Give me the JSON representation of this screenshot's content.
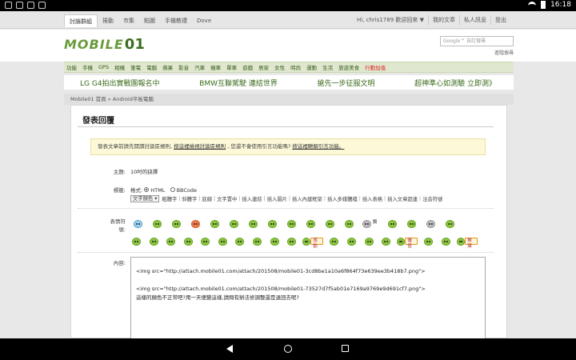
{
  "status_bar": {
    "time": "16:18"
  },
  "top_nav": {
    "tabs": [
      "討論群組",
      "捲動",
      "市集",
      "點圖",
      "手機教禮",
      "Dove"
    ],
    "user_links": [
      "Hi, chris1789 歡迎回來 ▼",
      "我的文章",
      "私人訊息",
      "登出"
    ]
  },
  "header": {
    "logo_text": "MOBILE",
    "logo_num": "01",
    "search_placeholder": "Google™ 自訂搜尋",
    "advanced_search": "進階搜尋"
  },
  "categories": [
    "功能",
    "手機",
    "GPS",
    "相機",
    "筆電",
    "電腦",
    "蘋果",
    "影音",
    "汽車",
    "機車",
    "單車",
    "遊戲",
    "居家",
    "女性",
    "時尚",
    "運動",
    "生活",
    "旅遊美食",
    "行動加值"
  ],
  "promos": [
    "LG G4拍出實戰團報名中",
    "BMW互聯駕駛 連結世界",
    "搶先一步征服文明",
    "超神準心如測驗 立即測》"
  ],
  "breadcrumb": "Mobile01 首頁 » Android平板電腦",
  "form": {
    "title": "發表回覆",
    "notice_text": "發表文章前請先閱讀討論區規則,",
    "notice_link1": "按這裡檢視討論區規則",
    "notice_mid": ", 您還不會使用引言功能嗎?",
    "notice_link2": "按這裡瞭解引言功能。",
    "subject_label": "主題:",
    "subject_value": "10吋的抉擇",
    "tags_label": "標籤:",
    "format_label": "格式:",
    "format_html": "HTML",
    "format_bbcode": "BBCode",
    "color_select": "文字顏色 ▾",
    "toolbar_items": [
      "粗體字",
      "斜體字",
      "底線",
      "文字置中",
      "插入連結",
      "插入圖片",
      "插入內建框架",
      "插入多媒體檔",
      "插入表格",
      "插入文章超連",
      "注音符號"
    ],
    "emoji_label": "表情符號:",
    "emoji_signs": [
      "讚",
      "感動",
      "優值",
      "推爆"
    ],
    "content_label": "內容:",
    "content_lines": [
      "<img src=\"http://attach.mobile01.com/attach/201508/mobile01-3cd8be1a10a6f864f73e639ee3b418b7.png\">",
      "",
      "<img src=\"http://attach.mobile01.com/attach/201508/mobile01-73527d7f5ab01e7169a9769e9d691cf7.png\">",
      "這樣的顏色不正常吧?用一天便變這樣,請問有辦法修調整還是退回去呢?"
    ]
  }
}
